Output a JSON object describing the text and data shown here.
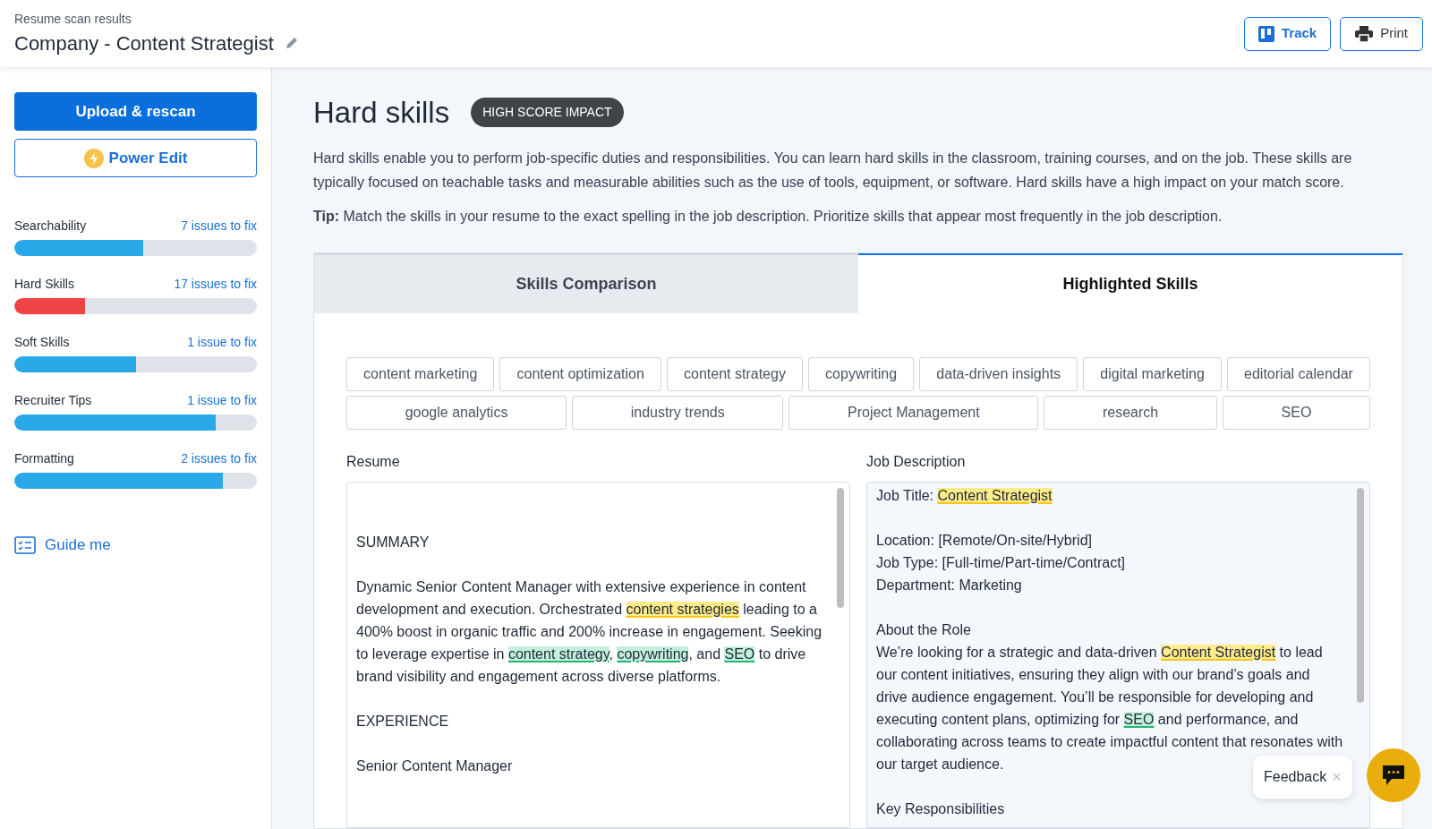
{
  "header": {
    "subtitle": "Resume scan results",
    "title": "Company - Content Strategist",
    "buttons": [
      {
        "kind": "track",
        "label": "Track"
      },
      {
        "kind": "print",
        "label": "Print"
      }
    ]
  },
  "sidebar": {
    "primary_button": "Upload & rescan",
    "power_button": "Power Edit",
    "scores": [
      {
        "name": "Searchability",
        "issues": "7 issues to fix",
        "level": 0.53,
        "color": "#29a9e8"
      },
      {
        "name": "Hard Skills",
        "issues": "17 issues to fix",
        "level": 0.29,
        "color": "#ef4444"
      },
      {
        "name": "Soft Skills",
        "issues": "1 issue to fix",
        "level": 0.5,
        "color": "#29a9e8"
      },
      {
        "name": "Recruiter Tips",
        "issues": "1 issue to fix",
        "level": 0.83,
        "color": "#29a9e8"
      },
      {
        "name": "Formatting",
        "issues": "2 issues to fix",
        "level": 0.86,
        "color": "#29a9e8"
      }
    ],
    "guide_link": "Guide me"
  },
  "main": {
    "title": "Hard skills",
    "badge": "HIGH SCORE IMPACT",
    "description": "Hard skills enable you to perform job-specific duties and responsibilities. You can learn hard skills in the classroom, training courses, and on the job. These skills are typically focused on teachable tasks and measurable abilities such as the use of tools, equipment, or software. Hard skills have a high impact on your match score.",
    "tip": "**Tip:** Match the skills in your resume to the exact spelling in the job description. Prioritize skills that appear most frequently in the job description.",
    "tabs": [
      {
        "label": "Skills Comparison",
        "selected": false
      },
      {
        "label": "Highlighted Skills",
        "selected": true
      }
    ],
    "skill_rows": [
      [
        "content marketing",
        "content optimization",
        "content strategy",
        "copywriting",
        "data-driven insights",
        "digital marketing",
        "editorial calendar"
      ],
      [
        "google analytics",
        "industry trends",
        "Project Management",
        "research",
        "SEO"
      ]
    ],
    "resume": {
      "label": "Resume",
      "blocks": [
        [
          [
            {
              "text": "SUMMARY",
              "kind": "plain"
            }
          ]
        ],
        [
          [
            {
              "text": "Dynamic Senior Content Manager with extensive experience in content development and execution. Orchestrated ",
              "kind": "plain"
            },
            {
              "text": "content strategies",
              "kind": "partial"
            },
            {
              "text": " leading to a 400% boost in organic traffic and 200% increase in engagement. Seeking to leverage expertise in ",
              "kind": "plain"
            },
            {
              "text": "content strategy",
              "kind": "match"
            },
            {
              "text": ", ",
              "kind": "plain"
            },
            {
              "text": "copywriting",
              "kind": "match"
            },
            {
              "text": ", and ",
              "kind": "plain"
            },
            {
              "text": "SEO",
              "kind": "match"
            },
            {
              "text": " to drive brand visibility and engagement across diverse platforms.",
              "kind": "plain"
            }
          ]
        ],
        [
          [
            {
              "text": "EXPERIENCE",
              "kind": "plain"
            }
          ]
        ],
        [
          [
            {
              "text": "Senior Content Manager",
              "kind": "plain"
            }
          ]
        ]
      ]
    },
    "job": {
      "label": "Job Description",
      "blocks": [
        [
          [
            {
              "text": "Job Title: ",
              "kind": "plain"
            },
            {
              "text": "Content Strategist",
              "kind": "partial"
            }
          ]
        ],
        [
          [
            {
              "text": "Location: [Remote/On-site/Hybrid]",
              "kind": "plain"
            }
          ],
          [
            {
              "text": "Job Type: [Full-time/Part-time/Contract]",
              "kind": "plain"
            }
          ],
          [
            {
              "text": "Department: Marketing",
              "kind": "plain"
            }
          ]
        ],
        [
          [
            {
              "text": "About the Role",
              "kind": "plain"
            }
          ],
          [
            {
              "text": "We’re looking for a strategic and data-driven ",
              "kind": "plain"
            },
            {
              "text": "Content Strategist",
              "kind": "partial"
            },
            {
              "text": " to lead our content initiatives, ensuring they align with our brand’s goals and drive audience engagement. You’ll be responsible for developing and executing content plans, optimizing for ",
              "kind": "plain"
            },
            {
              "text": "SEO",
              "kind": "match"
            },
            {
              "text": " and performance, and collaborating across teams to create impactful content that resonates with our target audience.",
              "kind": "plain"
            }
          ]
        ],
        [
          [
            {
              "text": "Key Responsibilities",
              "kind": "plain"
            }
          ]
        ]
      ]
    }
  },
  "feedback": {
    "label": "Feedback",
    "close": "×"
  }
}
